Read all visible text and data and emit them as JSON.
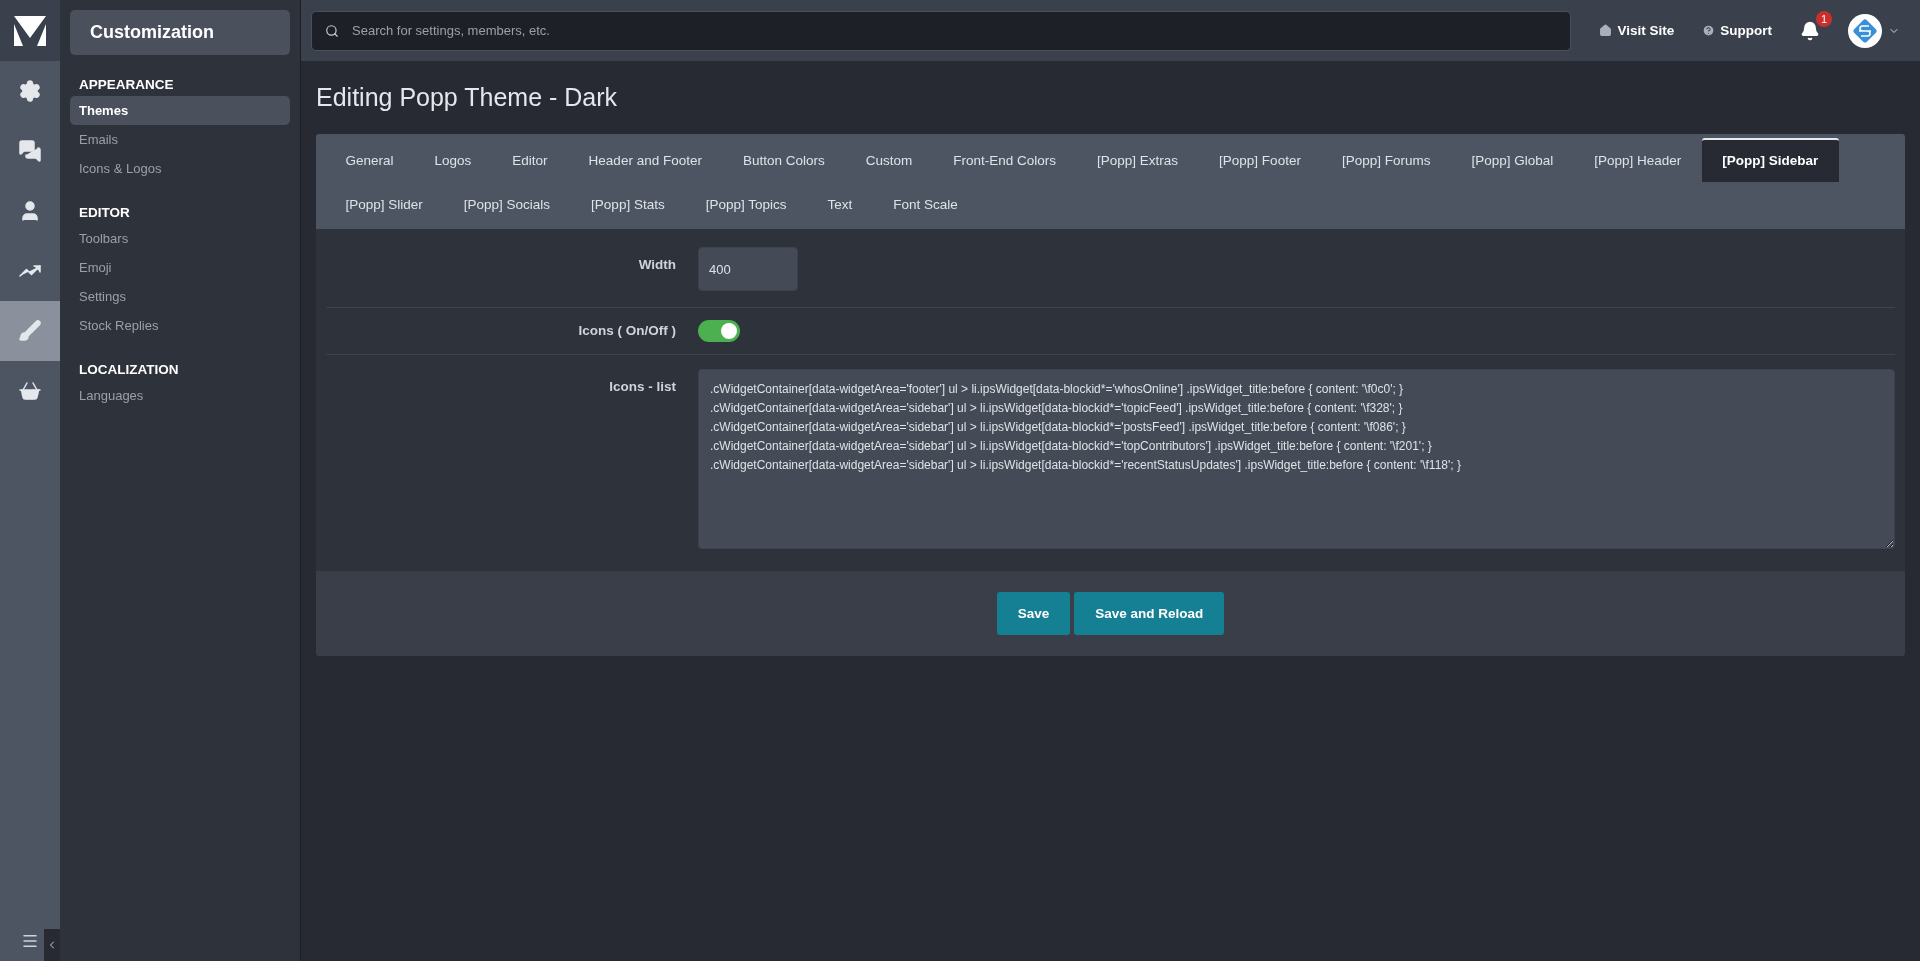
{
  "rail": {
    "items": [
      {
        "selected": false
      },
      {
        "selected": false
      },
      {
        "selected": false
      },
      {
        "selected": false
      },
      {
        "selected": true
      },
      {
        "selected": false
      }
    ]
  },
  "subnav": {
    "title": "Customization",
    "sections": [
      {
        "heading": "APPEARANCE",
        "items": [
          {
            "label": "Themes",
            "selected": true
          },
          {
            "label": "Emails",
            "selected": false
          },
          {
            "label": "Icons & Logos",
            "selected": false
          }
        ]
      },
      {
        "heading": "EDITOR",
        "items": [
          {
            "label": "Toolbars",
            "selected": false
          },
          {
            "label": "Emoji",
            "selected": false
          },
          {
            "label": "Settings",
            "selected": false
          },
          {
            "label": "Stock Replies",
            "selected": false
          }
        ]
      },
      {
        "heading": "LOCALIZATION",
        "items": [
          {
            "label": "Languages",
            "selected": false
          }
        ]
      }
    ]
  },
  "topbar": {
    "search_placeholder": "Search for settings, members, etc.",
    "links": [
      "Visit Site",
      "Support"
    ],
    "notification_count": "1"
  },
  "page_title": "Editing Popp Theme - Dark",
  "tab_rows": [
    [
      {
        "label": "General",
        "selected": false
      },
      {
        "label": "Logos",
        "selected": false
      },
      {
        "label": "Editor",
        "selected": false
      },
      {
        "label": "Header and Footer",
        "selected": false
      },
      {
        "label": "Button Colors",
        "selected": false
      },
      {
        "label": "Custom",
        "selected": false
      },
      {
        "label": "Front-End Colors",
        "selected": false
      },
      {
        "label": "[Popp] Extras",
        "selected": false
      },
      {
        "label": "[Popp] Footer",
        "selected": false
      },
      {
        "label": "[Popp] Forums",
        "selected": false
      },
      {
        "label": "[Popp] Global",
        "selected": false
      },
      {
        "label": "[Popp] Header",
        "selected": false
      },
      {
        "label": "[Popp] Sidebar",
        "selected": true
      }
    ],
    [
      {
        "label": "[Popp] Slider",
        "selected": false
      },
      {
        "label": "[Popp] Socials",
        "selected": false
      },
      {
        "label": "[Popp] Stats",
        "selected": false
      },
      {
        "label": "[Popp] Topics",
        "selected": false
      },
      {
        "label": "Text",
        "selected": false
      },
      {
        "label": "Font Scale",
        "selected": false
      }
    ]
  ],
  "form": [
    {
      "kind": "text",
      "label": "Width",
      "value": "400"
    },
    {
      "kind": "toggle",
      "label": "Icons ( On/Off )",
      "on": true
    },
    {
      "kind": "textarea",
      "label": "Icons - list",
      "lines": [
        ".cWidgetContainer[data-widgetArea='footer'] ul > li.ipsWidget[data-blockid*='whosOnline'] .ipsWidget_title:before { content: '\\f0c0'; }",
        ".cWidgetContainer[data-widgetArea='sidebar'] ul > li.ipsWidget[data-blockid*='topicFeed'] .ipsWidget_title:before { content: '\\f328'; }",
        ".cWidgetContainer[data-widgetArea='sidebar'] ul > li.ipsWidget[data-blockid*='postsFeed'] .ipsWidget_title:before { content: '\\f086'; }",
        ".cWidgetContainer[data-widgetArea='sidebar'] ul > li.ipsWidget[data-blockid*='topContributors'] .ipsWidget_title:before { content: '\\f201'; }",
        ".cWidgetContainer[data-widgetArea='sidebar'] ul > li.ipsWidget[data-blockid*='recentStatusUpdates'] .ipsWidget_title:before { content: '\\f118'; }"
      ]
    }
  ],
  "buttons": [
    "Save",
    "Save and Reload"
  ]
}
